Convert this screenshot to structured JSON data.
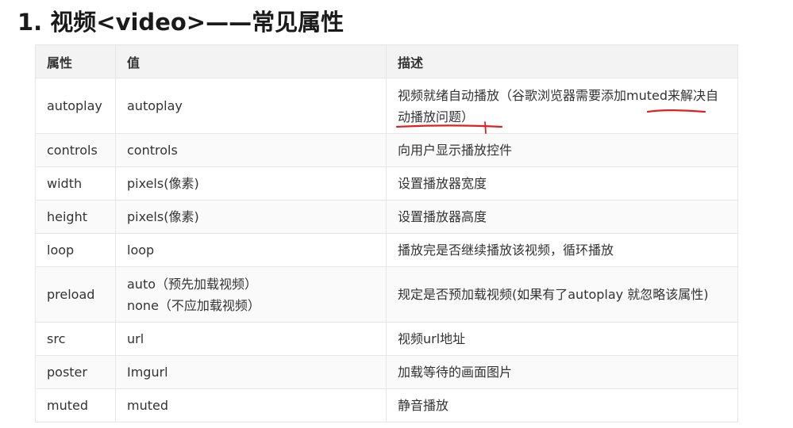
{
  "heading": "1. 视频<video>——常见属性",
  "columns": [
    "属性",
    "值",
    "描述"
  ],
  "rows": [
    {
      "attr": "autoplay",
      "value": [
        "autoplay"
      ],
      "desc": "视频就绪自动播放（谷歌浏览器需要添加muted来解决自动播放问题）"
    },
    {
      "attr": "controls",
      "value": [
        "controls"
      ],
      "desc": "向用户显示播放控件"
    },
    {
      "attr": "width",
      "value": [
        "pixels(像素)"
      ],
      "desc": "设置播放器宽度"
    },
    {
      "attr": "height",
      "value": [
        "pixels(像素)"
      ],
      "desc": "设置播放器高度"
    },
    {
      "attr": "loop",
      "value": [
        "loop"
      ],
      "desc": "播放完是否继续播放该视频，循环播放"
    },
    {
      "attr": "preload",
      "value": [
        "auto（预先加载视频）",
        "none（不应加载视频）"
      ],
      "desc": "规定是否预加载视频(如果有了autoplay 就忽略该属性)"
    },
    {
      "attr": "src",
      "value": [
        "url"
      ],
      "desc": "视频url地址"
    },
    {
      "attr": "poster",
      "value": [
        "Imgurl"
      ],
      "desc": "加载等待的画面图片"
    },
    {
      "attr": "muted",
      "value": [
        "muted"
      ],
      "desc": "静音播放"
    }
  ],
  "annotation_color": "#e02020"
}
